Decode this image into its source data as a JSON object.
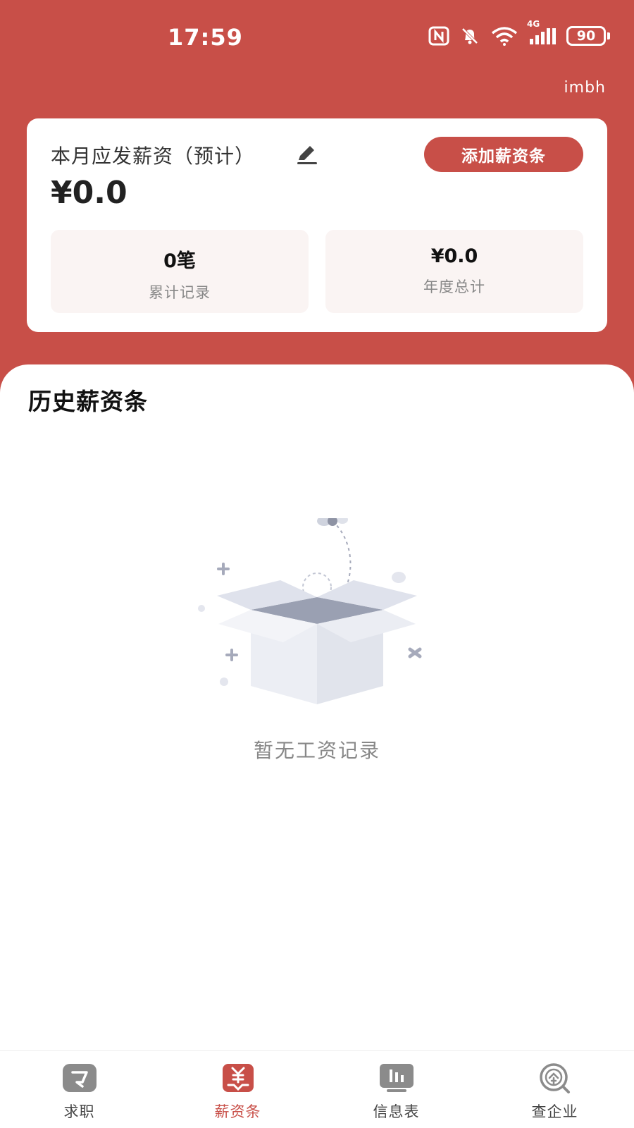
{
  "colors": {
    "brand": "#c84f48",
    "stat_box_bg": "#faf4f3",
    "muted_text": "#888888"
  },
  "status_bar": {
    "time": "17:59",
    "battery": "90",
    "network": "4G",
    "icons": [
      "nfc-icon",
      "bell-mute-icon",
      "wifi-icon",
      "signal-icon",
      "battery-icon"
    ]
  },
  "header": {
    "user": "imbh"
  },
  "summary": {
    "month_label": "本月应发薪资（预计）",
    "month_amount": "¥0.0",
    "add_button_label": "添加薪资条",
    "stats": [
      {
        "value": "0笔",
        "label": "累计记录"
      },
      {
        "value": "¥0.0",
        "label": "年度总计"
      }
    ]
  },
  "history": {
    "title": "历史薪资条",
    "empty_text": "暂无工资记录"
  },
  "bottom_nav": {
    "items": [
      {
        "label": "求职",
        "icon": "job-icon"
      },
      {
        "label": "薪资条",
        "icon": "salary-icon",
        "active": true
      },
      {
        "label": "信息表",
        "icon": "info-table-icon"
      },
      {
        "label": "查企业",
        "icon": "company-search-icon"
      }
    ]
  }
}
